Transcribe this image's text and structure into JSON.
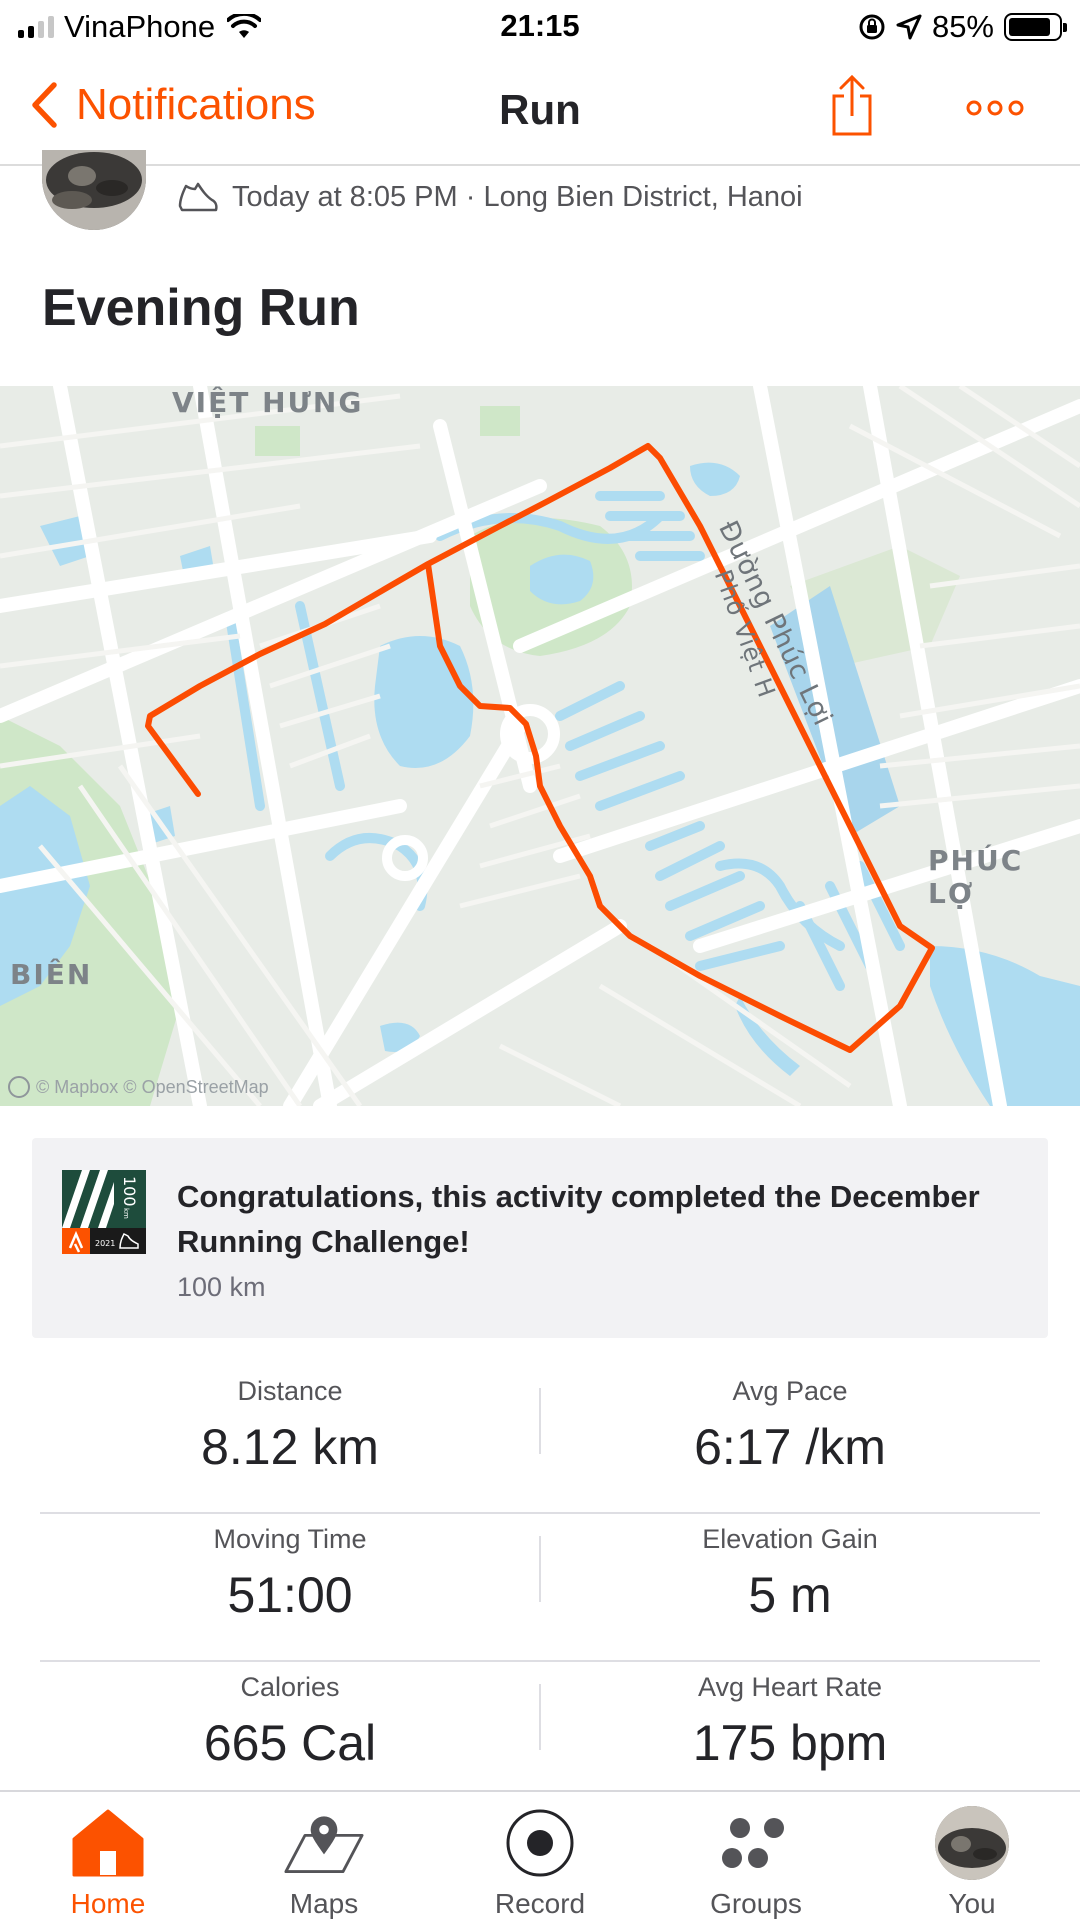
{
  "status_bar": {
    "carrier": "VinaPhone",
    "time": "21:15",
    "battery_percent": "85%",
    "battery_level": 0.85
  },
  "nav": {
    "back_label": "Notifications",
    "title": "Run",
    "share_icon": "share-icon",
    "more_icon": "more-icon"
  },
  "activity": {
    "meta": "Today at 8:05 PM · Long Bien District, Hanoi",
    "type_icon": "shoe-icon",
    "title": "Evening Run"
  },
  "map": {
    "labels": {
      "viet_hung": "VIỆT HƯNG",
      "duong_phuc_loi": "Đường Phúc Lợi",
      "pho_viet_hung": "Phố Việt H",
      "phuc_loi": "PHÚC LỢ",
      "bien": "BIÊN"
    },
    "attribution": "© Mapbox © OpenStreetMap",
    "route_color": "#fc4c02"
  },
  "challenge": {
    "badge_icon": "challenge-badge-icon",
    "text": "Congratulations, this activity completed the December Running Challenge!",
    "subtext": "100 km",
    "badge_text": "100",
    "badge_unit": "km",
    "badge_year": "2021"
  },
  "stats": [
    [
      {
        "label": "Distance",
        "value": "8.12 km"
      },
      {
        "label": "Avg Pace",
        "value": "6:17 /km"
      }
    ],
    [
      {
        "label": "Moving Time",
        "value": "51:00"
      },
      {
        "label": "Elevation Gain",
        "value": "5 m"
      }
    ],
    [
      {
        "label": "Calories",
        "value": "665 Cal"
      },
      {
        "label": "Avg Heart Rate",
        "value": "175 bpm"
      }
    ]
  ],
  "tabbar": {
    "items": [
      {
        "label": "Home",
        "icon": "home-icon",
        "active": true
      },
      {
        "label": "Maps",
        "icon": "maps-icon",
        "active": false
      },
      {
        "label": "Record",
        "icon": "record-icon",
        "active": false
      },
      {
        "label": "Groups",
        "icon": "groups-icon",
        "active": false
      },
      {
        "label": "You",
        "icon": "avatar",
        "active": false
      }
    ]
  },
  "colors": {
    "brand": "#fc5200",
    "text": "#242428",
    "secondary_text": "#545458",
    "water": "#aedcf1",
    "park": "#c8e6c3"
  }
}
